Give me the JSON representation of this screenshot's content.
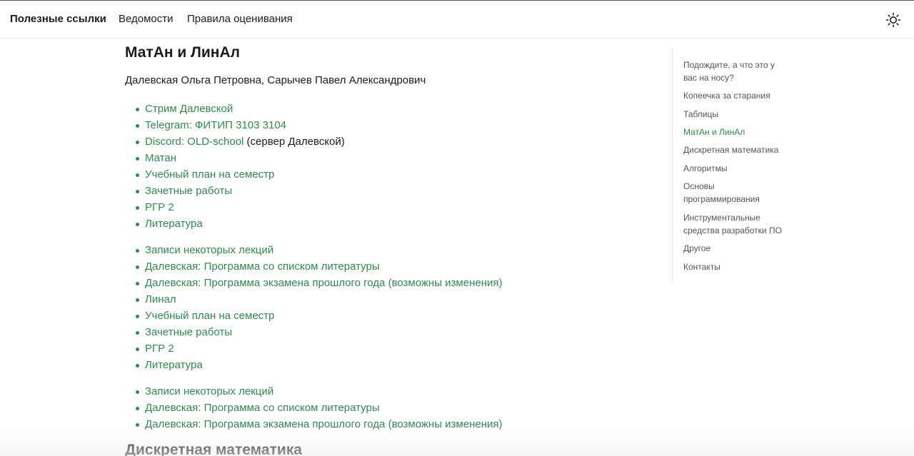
{
  "nav": {
    "brand": "Полезные ссылки",
    "links": [
      "Ведомости",
      "Правила оценивания"
    ],
    "theme_icon": "sun-icon"
  },
  "section": {
    "title": "МатАн и ЛинАл",
    "authors": "Далевская Ольга Петровна, Сарычев Павел Александрович"
  },
  "list1": [
    {
      "text": "Стрим Далевской",
      "note": ""
    },
    {
      "text": "Telegram: ФИТИП 3103 3104",
      "note": ""
    },
    {
      "text": "Discord: OLD-school",
      "note": " (сервер Далевской)"
    },
    {
      "text": "Матан",
      "note": ""
    },
    {
      "text": "Учебный план на семестр",
      "note": ""
    },
    {
      "text": "Зачетные работы",
      "note": ""
    },
    {
      "text": "РГР 2",
      "note": ""
    },
    {
      "text": "Литература",
      "note": ""
    }
  ],
  "list2": [
    {
      "text": "Записи некоторых лекций"
    },
    {
      "text": "Далевская: Программа со списком литературы"
    },
    {
      "text": "Далевская: Программа экзамена прошлого года (возможны изменения)"
    },
    {
      "text": "Линал"
    },
    {
      "text": "Учебный план на семестр"
    },
    {
      "text": "Зачетные работы"
    },
    {
      "text": "РГР 2"
    },
    {
      "text": "Литература"
    }
  ],
  "list3": [
    {
      "text": "Записи некоторых лекций"
    },
    {
      "text": "Далевская: Программа со списком литературы"
    },
    {
      "text": "Далевская: Программа экзамена прошлого года (возможны изменения)"
    }
  ],
  "next_section_title": "Дискретная математика",
  "toc": {
    "items": [
      "Подождите, а что это у вас на носу?",
      "Копеечка за старания",
      "Таблицы",
      "МатАн и ЛинАл",
      "Дискретная математика",
      "Алгоритмы",
      "Основы программирования",
      "Инструментальные средства разработки ПО",
      "Другое",
      "Контакты"
    ],
    "active": "МатАн и ЛинАл"
  },
  "colors": {
    "link": "#2e8b4e",
    "text": "#1c1c1c",
    "toc_text": "#555555"
  }
}
